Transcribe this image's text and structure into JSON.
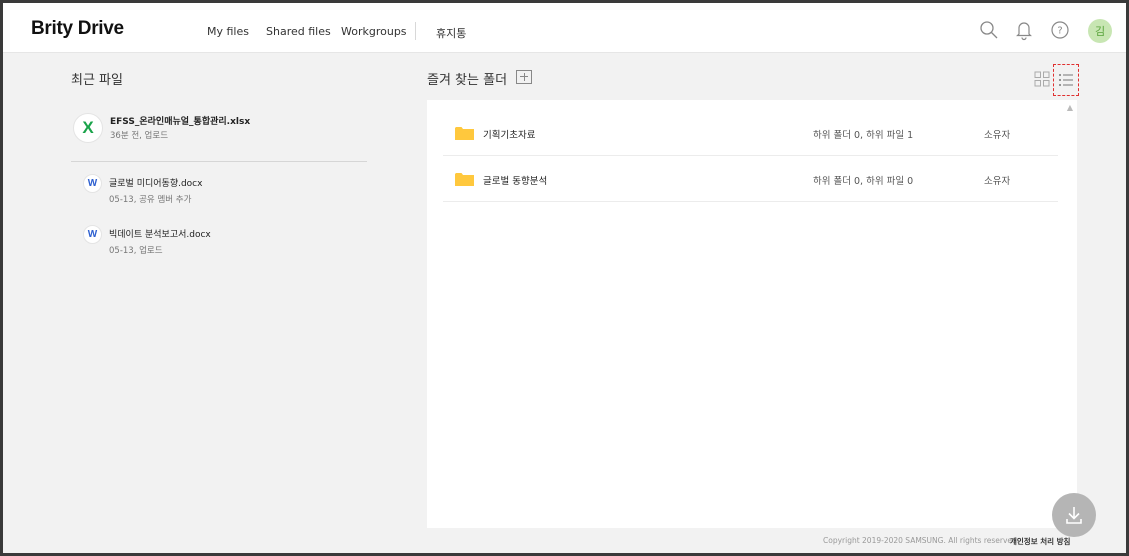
{
  "app": {
    "logo": "Brity Drive"
  },
  "header": {
    "nav": [
      {
        "label": "My files"
      },
      {
        "label": "Shared files"
      },
      {
        "label": "Workgroups"
      },
      {
        "label": "휴지통"
      }
    ],
    "icons": [
      "search-icon",
      "bell-icon",
      "help-icon"
    ],
    "avatar_initial": "김"
  },
  "recent": {
    "title": "최근 파일",
    "pinned": {
      "icon": "X",
      "icon_color": "#1aa34a",
      "name": "EFSS_온라인매뉴얼_통합관리.xlsx",
      "meta": "36분 전, 업로드"
    },
    "items": [
      {
        "icon": "W",
        "icon_color": "#2d5fd0",
        "name": "글로벌 미디어동향.docx",
        "meta": "05-13, 공유 멤버 추가"
      },
      {
        "icon": "W",
        "icon_color": "#2d5fd0",
        "name": "빅데이트 분석보고서.docx",
        "meta": "05-13, 업로드"
      }
    ]
  },
  "favorites": {
    "title": "즐겨 찾는 폴더",
    "folders": [
      {
        "name": "기획기초자료",
        "info": "하위 폴더 0, 하위 파일 1",
        "owner": "소유자"
      },
      {
        "name": "글로벌 동향분석",
        "info": "하위 폴더 0, 하위 파일 0",
        "owner": "소유자"
      }
    ]
  },
  "footer": {
    "copyright": "Copyright 2019-2020 SAMSUNG. All rights reserved.",
    "privacy": "개인정보 처리 방침"
  },
  "colors": {
    "folder": "#ffc83d",
    "avatar_bg": "#c8e6b3",
    "excel": "#1aa34a",
    "word": "#2d5fd0"
  }
}
